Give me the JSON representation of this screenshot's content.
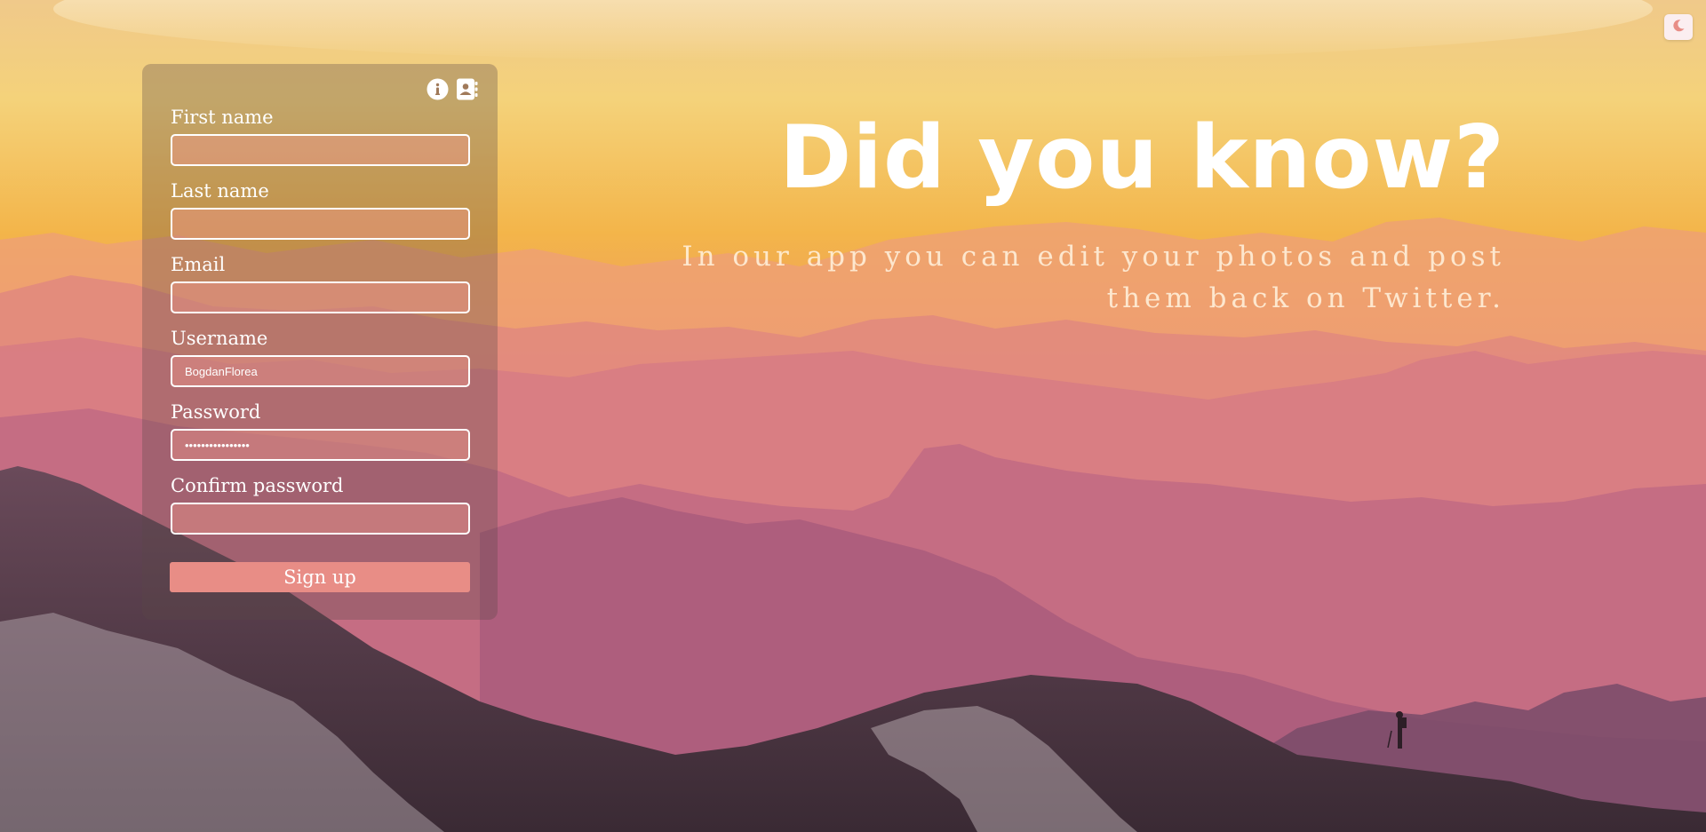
{
  "theme": {
    "toggle_icon": "moon-icon",
    "accent": "#e88d86",
    "text": "#ffffff"
  },
  "panel": {
    "icons": [
      "info-icon",
      "contact-book-icon"
    ],
    "fields": [
      {
        "label": "First name",
        "value": "",
        "type": "text"
      },
      {
        "label": "Last name",
        "value": "",
        "type": "text"
      },
      {
        "label": "Email",
        "value": "",
        "type": "email"
      },
      {
        "label": "Username",
        "value": "BogdanFlorea",
        "type": "text"
      },
      {
        "label": "Password",
        "value": "••••••••••••••••",
        "type": "password"
      },
      {
        "label": "Confirm password",
        "value": "",
        "type": "password"
      }
    ],
    "submit_label": "Sign up"
  },
  "hero": {
    "title": "Did you know?",
    "subtitle": "In our app you can edit your photos and post them back on Twitter."
  }
}
